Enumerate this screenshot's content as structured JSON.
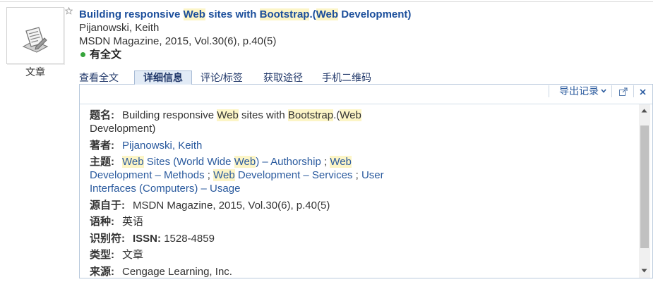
{
  "record": {
    "type_label": "文章",
    "title_segments": [
      "Building responsive ",
      "Web",
      " sites with ",
      "Bootstrap",
      ".(",
      "Web",
      " Development)"
    ],
    "author": "Pijanowski, Keith",
    "source": "MSDN Magazine, 2015, Vol.30(6), p.40(5)",
    "availability": "有全文"
  },
  "tabs": [
    {
      "label": "查看全文",
      "selected": false
    },
    {
      "label": "详细信息",
      "selected": true
    },
    {
      "label": "评论/标签",
      "selected": false
    },
    {
      "label": "获取途径",
      "selected": false
    },
    {
      "label": "手机二维码",
      "selected": false
    }
  ],
  "panel": {
    "export_label": "导出记录",
    "details": {
      "title": {
        "label": "题名:",
        "segments": [
          "Building responsive ",
          "Web",
          " sites with ",
          "Bootstrap",
          ".(",
          "Web",
          " Development)"
        ]
      },
      "author": {
        "label": "著者:",
        "value": "Pijanowski, Keith"
      },
      "subject": {
        "label": "主题:",
        "separator": ";",
        "items": [
          [
            "Web",
            " Sites (World Wide ",
            "Web",
            ") – Authorship"
          ],
          [
            "Web",
            " Development – Methods"
          ],
          [
            "Web",
            " Development – Services"
          ],
          [
            "User Interfaces (Computers) – Usage"
          ]
        ]
      },
      "source": {
        "label": "源自于:",
        "value": "MSDN Magazine, 2015, Vol.30(6), p.40(5)"
      },
      "language": {
        "label": "语种:",
        "value": "英语"
      },
      "identifier": {
        "label": "识别符:",
        "scheme": "ISSN:",
        "value": "1528-4859"
      },
      "type": {
        "label": "类型:",
        "value": "文章"
      },
      "origin": {
        "label": "来源:",
        "value": "Cengage Learning, Inc."
      }
    }
  },
  "icons": {
    "thumbnail": "document-icon",
    "favorite": "star-icon",
    "availability": "green-dot-icon",
    "export_menu": "chevron-down-icon",
    "popout": "new-window-icon",
    "close": "close-icon",
    "scroll_up": "arrow-up-icon",
    "scroll_down": "arrow-down-icon"
  },
  "colors": {
    "title": "#1b4e9b",
    "link": "#2a5a9e",
    "tab": "#21386a",
    "highlight": "#fcf5c6",
    "available": "#36a43b",
    "panel_border": "#b9c9dc"
  }
}
